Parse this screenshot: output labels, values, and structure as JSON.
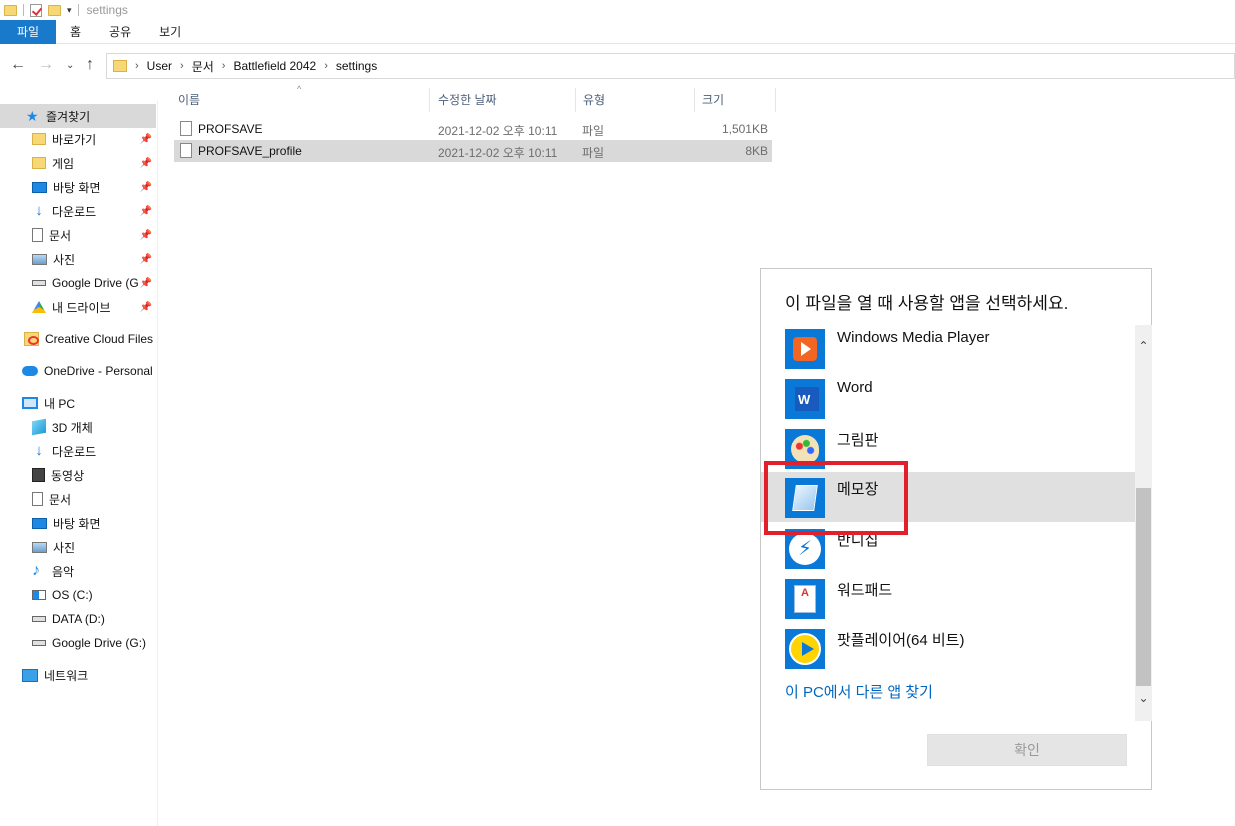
{
  "window": {
    "title": "settings"
  },
  "ribbon": {
    "tabs": [
      "파일",
      "홈",
      "공유",
      "보기"
    ]
  },
  "address": {
    "crumbs": [
      "User",
      "문서",
      "Battlefield 2042",
      "settings"
    ]
  },
  "sidebar": {
    "quick_access": "즐겨찾기",
    "pinned": [
      {
        "label": "바로가기",
        "icon": "folder-icon"
      },
      {
        "label": "게임",
        "icon": "folder-icon"
      },
      {
        "label": "바탕 화면",
        "icon": "desktop-icon"
      },
      {
        "label": "다운로드",
        "icon": "download-icon"
      },
      {
        "label": "문서",
        "icon": "document-icon"
      },
      {
        "label": "사진",
        "icon": "pictures-icon"
      },
      {
        "label": "Google Drive (G",
        "icon": "drive-icon"
      },
      {
        "label": "내 드라이브",
        "icon": "google-drive-icon"
      }
    ],
    "creative_cloud": "Creative Cloud Files",
    "onedrive": "OneDrive - Personal",
    "this_pc": "내 PC",
    "pc_items": [
      {
        "label": "3D 개체",
        "icon": "3d-objects-icon"
      },
      {
        "label": "다운로드",
        "icon": "download-icon"
      },
      {
        "label": "동영상",
        "icon": "video-icon"
      },
      {
        "label": "문서",
        "icon": "document-icon"
      },
      {
        "label": "바탕 화면",
        "icon": "desktop-icon"
      },
      {
        "label": "사진",
        "icon": "pictures-icon"
      },
      {
        "label": "음악",
        "icon": "music-icon"
      },
      {
        "label": "OS (C:)",
        "icon": "os-drive-icon"
      },
      {
        "label": "DATA (D:)",
        "icon": "drive-icon"
      },
      {
        "label": "Google Drive (G:)",
        "icon": "drive-icon"
      }
    ],
    "network": "네트워크"
  },
  "file_list": {
    "columns": {
      "name": "이름",
      "modified": "수정한 날짜",
      "type": "유형",
      "size": "크기"
    },
    "rows": [
      {
        "name": "PROFSAVE",
        "modified": "2021-12-02 오후 10:11",
        "type": "파일",
        "size": "1,501KB",
        "selected": false
      },
      {
        "name": "PROFSAVE_profile",
        "modified": "2021-12-02 오후 10:11",
        "type": "파일",
        "size": "8KB",
        "selected": true
      }
    ]
  },
  "dialog": {
    "title": "이 파일을 열 때 사용할 앱을 선택하세요.",
    "apps": [
      {
        "name": "Windows Media Player",
        "icon": "windows-media-player-icon"
      },
      {
        "name": "Word",
        "icon": "word-icon"
      },
      {
        "name": "그림판",
        "icon": "paint-icon"
      },
      {
        "name": "메모장",
        "icon": "notepad-icon",
        "selected": true
      },
      {
        "name": "반디집",
        "icon": "bandizip-icon"
      },
      {
        "name": "워드패드",
        "icon": "wordpad-icon"
      },
      {
        "name": "팟플레이어(64 비트)",
        "icon": "potplayer-icon"
      }
    ],
    "find_link": "이 PC에서 다른 앱 찾기",
    "ok_label": "확인"
  },
  "colors": {
    "accent": "#0a78d7",
    "file_tab": "#1979ca",
    "highlight": "#e0212b",
    "link": "#0067c0"
  }
}
